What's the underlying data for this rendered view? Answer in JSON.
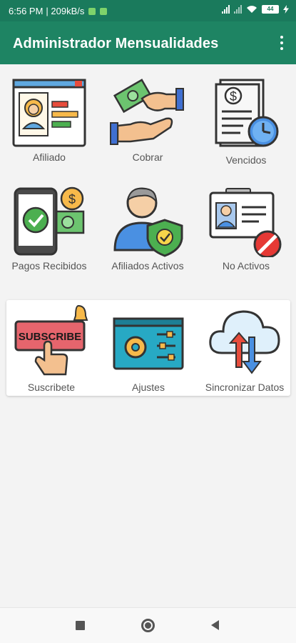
{
  "status_bar": {
    "time": "6:56 PM",
    "speed": "| 209kB/s",
    "battery": "44"
  },
  "app_bar": {
    "title": "Administrador Mensualidades",
    "menu_icon": "more-vert-icon"
  },
  "tiles": [
    {
      "label": "Afiliado",
      "icon": "member-profile-icon"
    },
    {
      "label": "Cobrar",
      "icon": "charge-money-hands-icon"
    },
    {
      "label": "Vencidos",
      "icon": "invoice-clock-icon"
    },
    {
      "label": "Pagos Recibidos",
      "icon": "phone-payment-icon"
    },
    {
      "label": "Afiliados Activos",
      "icon": "user-shield-icon"
    },
    {
      "label": "No Activos",
      "icon": "id-card-blocked-icon"
    }
  ],
  "card_tiles": [
    {
      "label": "Suscribete",
      "icon": "subscribe-icon",
      "text": "SUBSCRIBE"
    },
    {
      "label": "Ajustes",
      "icon": "settings-panel-icon"
    },
    {
      "label": "Sincronizar Datos",
      "icon": "cloud-sync-icon"
    }
  ],
  "nav_bar": {
    "recents": "recents-square-icon",
    "home": "home-circle-icon",
    "back": "back-triangle-icon"
  },
  "colors": {
    "status_bar": "#1a7a5c",
    "app_bar": "#1e8463",
    "background": "#f3f3f3"
  }
}
